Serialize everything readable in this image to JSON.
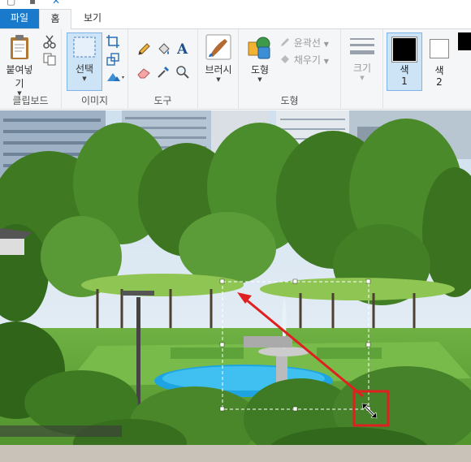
{
  "tabs": {
    "file": "파일",
    "home": "홈",
    "view": "보기"
  },
  "clipboard": {
    "paste_label": "붙여넣기",
    "group_label": "클립보드"
  },
  "image": {
    "select_label": "선택",
    "group_label": "이미지"
  },
  "tools": {
    "group_label": "도구"
  },
  "brushes": {
    "label": "브러시"
  },
  "shapes": {
    "shapes_label": "도형",
    "outline_label": "윤곽선",
    "fill_label": "채우기",
    "group_label": "도형"
  },
  "size": {
    "label": "크기"
  },
  "colors": {
    "color1_label_a": "색",
    "color1_label_b": "1",
    "color2_label_a": "색",
    "color2_label_b": "2",
    "color1": "#000000",
    "color2": "#ffffff"
  },
  "accent": "#1979ca",
  "annotation": {
    "arrow_color": "#e02020",
    "selection_border": "#ffffff"
  }
}
